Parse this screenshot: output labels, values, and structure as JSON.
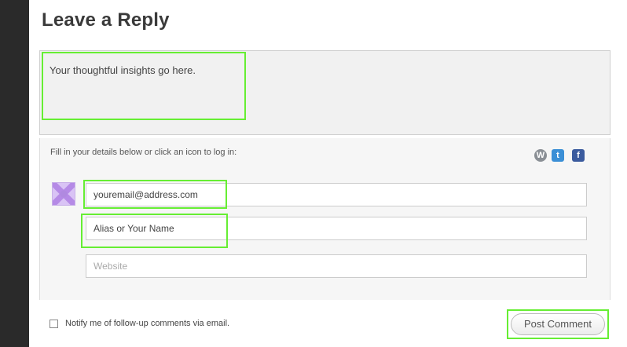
{
  "heading": "Leave a Reply",
  "comment": {
    "text": "Your thoughtful insights go here."
  },
  "details": {
    "label": "Fill in your details below or click an icon to log in:",
    "social_icons": [
      {
        "name": "wordpress-icon",
        "glyph": "W",
        "color": "#8a8f95"
      },
      {
        "name": "twitter-icon",
        "glyph": "t",
        "color": "#3b8fd6"
      },
      {
        "name": "facebook-icon",
        "glyph": "f",
        "color": "#3b5b9e"
      }
    ],
    "email_value": "youremail@address.com",
    "name_value": "Alias or Your Name",
    "website_placeholder": "Website"
  },
  "footer": {
    "notify_label": "Notify me of follow-up comments via email.",
    "post_button": "Post Comment"
  },
  "colors": {
    "highlight": "#66ee33",
    "background": "#2a2a2a",
    "heading": "#3a3a3a"
  }
}
